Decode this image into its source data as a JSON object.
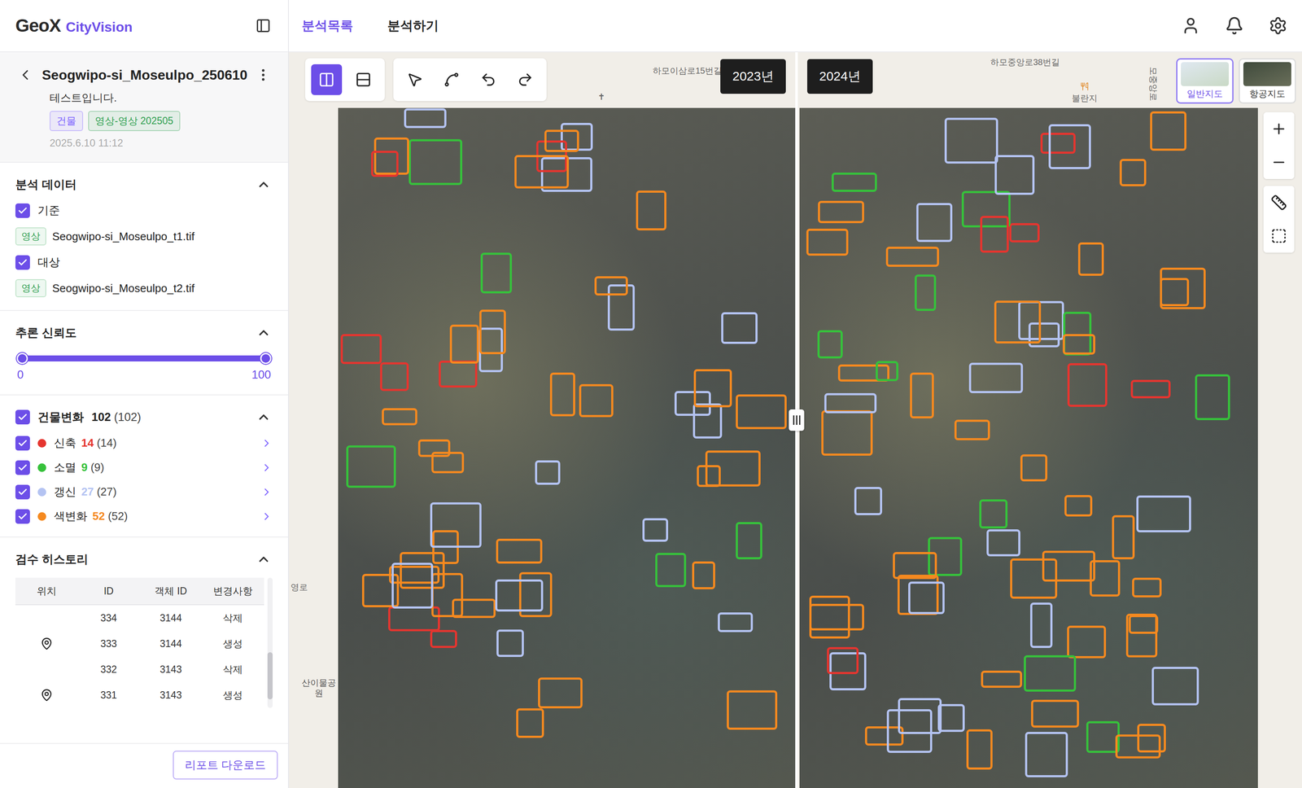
{
  "app": {
    "logo": "GeoX",
    "product": "CityVision"
  },
  "nav": [
    {
      "label": "분석목록",
      "selected": true
    },
    {
      "label": "분석하기",
      "selected": false
    }
  ],
  "analysis": {
    "title": "Seogwipo-si_Moseulpo_250610",
    "description": "테스트입니다.",
    "tags": [
      {
        "label": "건물",
        "color": "#7b61ff"
      },
      {
        "label": "영상-영상 202505",
        "color": "#2e9e4f"
      }
    ],
    "date": "2025.6.10 11:12"
  },
  "analysisData": {
    "title": "분석 데이터",
    "expanded": true,
    "items": [
      {
        "label": "기준",
        "checked": true,
        "tag": "영상",
        "file": "Seogwipo-si_Moseulpo_t1.tif"
      },
      {
        "label": "대상",
        "checked": true,
        "tag": "영상",
        "file": "Seogwipo-si_Moseulpo_t2.tif"
      }
    ]
  },
  "confidence": {
    "title": "추론 신뢰도",
    "expanded": true,
    "min": "0",
    "max": "100",
    "low": 0,
    "high": 1
  },
  "buildingChange": {
    "title": "건물변화",
    "count": "102",
    "total": "(102)",
    "checked": true,
    "expanded": true,
    "categories": [
      {
        "label": "신축",
        "count": "14",
        "total": "(14)",
        "checked": true,
        "color": "#e5352f"
      },
      {
        "label": "소멸",
        "count": "9",
        "total": "(9)",
        "checked": true,
        "color": "#36c13b"
      },
      {
        "label": "갱신",
        "count": "27",
        "total": "(27)",
        "checked": true,
        "color": "#b4c3f2"
      },
      {
        "label": "색변화",
        "count": "52",
        "total": "(52)",
        "checked": true,
        "color": "#f5891f"
      }
    ]
  },
  "history": {
    "title": "검수 히스토리",
    "expanded": true,
    "columns": [
      "위치",
      "ID",
      "객체 ID",
      "변경사항"
    ],
    "rows": [
      {
        "pin": false,
        "id": "334",
        "objectId": "3144",
        "change": "삭제"
      },
      {
        "pin": true,
        "id": "333",
        "objectId": "3144",
        "change": "생성"
      },
      {
        "pin": false,
        "id": "332",
        "objectId": "3143",
        "change": "삭제"
      },
      {
        "pin": true,
        "id": "331",
        "objectId": "3143",
        "change": "생성"
      }
    ]
  },
  "reportButton": "리포트 다운로드",
  "map": {
    "viewModes": [
      {
        "kind": "swipeVertical",
        "selected": true
      },
      {
        "kind": "swipeHorizontal",
        "selected": false
      }
    ],
    "editTools": [
      {
        "kind": "select"
      },
      {
        "kind": "vertex"
      },
      {
        "kind": "undo"
      },
      {
        "kind": "redo"
      }
    ],
    "years": [
      "2023년",
      "2024년"
    ],
    "layers": [
      {
        "label": "일반지도",
        "selected": true
      },
      {
        "label": "항공지도",
        "selected": false
      }
    ],
    "controls": [
      {
        "kind": "zoomIn"
      },
      {
        "kind": "zoomOut"
      },
      {
        "kind": "distance"
      },
      {
        "kind": "area"
      }
    ],
    "labels": [
      "하모이삼로15번길",
      "✝",
      "산이물공원",
      "영로",
      "하모중앙로38번길",
      "불란지",
      "모중앙로"
    ]
  }
}
